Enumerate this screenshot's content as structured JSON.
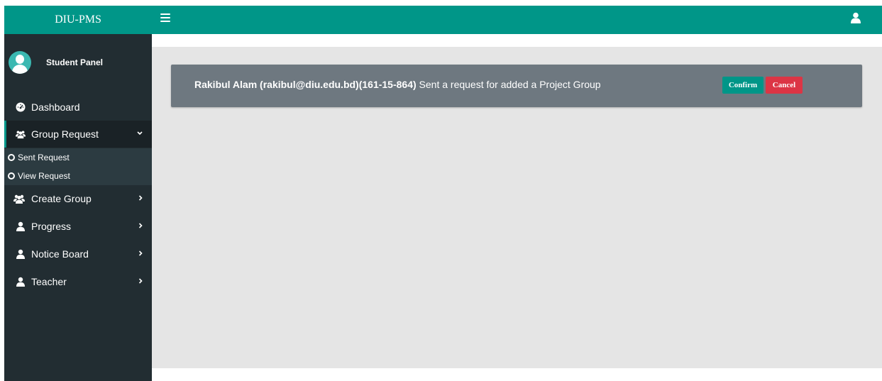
{
  "app": {
    "brand": "DIU-PMS"
  },
  "sidebar": {
    "panel_label": "Student Panel",
    "items": [
      {
        "label": "Dashboard",
        "icon": "dashboard-icon"
      },
      {
        "label": "Group Request",
        "icon": "users-icon",
        "expanded": true,
        "submenu": [
          {
            "label": "Sent Request"
          },
          {
            "label": "View Request"
          }
        ]
      },
      {
        "label": "Create Group",
        "icon": "users-icon"
      },
      {
        "label": "Progress",
        "icon": "user-icon"
      },
      {
        "label": "Notice Board",
        "icon": "user-icon"
      },
      {
        "label": "Teacher",
        "icon": "user-icon"
      }
    ]
  },
  "request": {
    "sender": "Rakibul Alam (rakibul@diu.edu.bd)(161-15-864)",
    "message": " Sent a request for added a Project Group",
    "confirm_label": "Confirm",
    "cancel_label": "Cancel"
  },
  "colors": {
    "accent": "#009688",
    "sidebar_bg": "#222d32",
    "danger": "#dc3545",
    "notice_bg": "#6e7880"
  }
}
